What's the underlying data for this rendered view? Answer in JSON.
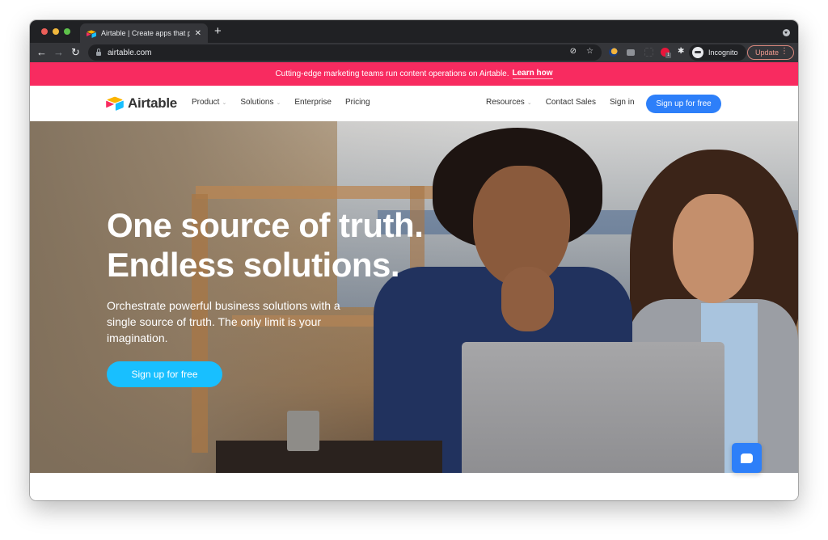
{
  "browser": {
    "tab": {
      "title": "Airtable | Create apps that perf",
      "favicon": "airtable-logo-icon",
      "close_icon": "close-icon"
    },
    "new_tab_icon": "plus-icon",
    "toolbar": {
      "back_icon": "arrow-left-icon",
      "forward_icon": "arrow-right-icon",
      "reload_icon": "reload-icon",
      "url": "airtable.com",
      "lock_icon": "lock-icon",
      "omnibox_icons": [
        "eye-slash-icon",
        "star-icon"
      ],
      "extensions": [
        "moon-extension-icon",
        "camera-extension-icon",
        "dashed-extension-icon",
        "red-extension-icon",
        "puzzle-icon"
      ],
      "extension_badge": "1",
      "profile_label": "Incognito",
      "update_label": "Update"
    },
    "glyphs": {
      "back": "←",
      "forward": "→",
      "reload": "↻",
      "close": "✕",
      "plus": "+",
      "eye_slash": "⊘",
      "star": "☆",
      "puzzle": "✱",
      "dots": "⋮"
    }
  },
  "announcement": {
    "text": "Cutting-edge marketing teams run content operations on Airtable.",
    "link": "Learn how",
    "color": "#f82b60"
  },
  "site_nav": {
    "logo_text": "Airtable",
    "left_items": [
      {
        "label": "Product",
        "has_dropdown": true
      },
      {
        "label": "Solutions",
        "has_dropdown": true
      },
      {
        "label": "Enterprise",
        "has_dropdown": false
      },
      {
        "label": "Pricing",
        "has_dropdown": false
      }
    ],
    "right_items": [
      {
        "label": "Resources",
        "has_dropdown": true
      },
      {
        "label": "Contact Sales",
        "has_dropdown": false
      },
      {
        "label": "Sign in",
        "has_dropdown": false
      }
    ],
    "cta_label": "Sign up for free",
    "chevron": "⌄",
    "cta_color": "#2d7ff9"
  },
  "hero": {
    "title_line1": "One source of truth.",
    "title_line2": "Endless solutions.",
    "subtitle": "Orchestrate powerful business solutions with a single source of truth. The only limit is your imagination.",
    "cta_label": "Sign up for free",
    "cta_color": "#18bfff",
    "image_description": "Two women looking at a laptop in a warehouse"
  },
  "chat_widget": {
    "icon": "chat-bubble-icon",
    "color": "#2d7ff9"
  }
}
